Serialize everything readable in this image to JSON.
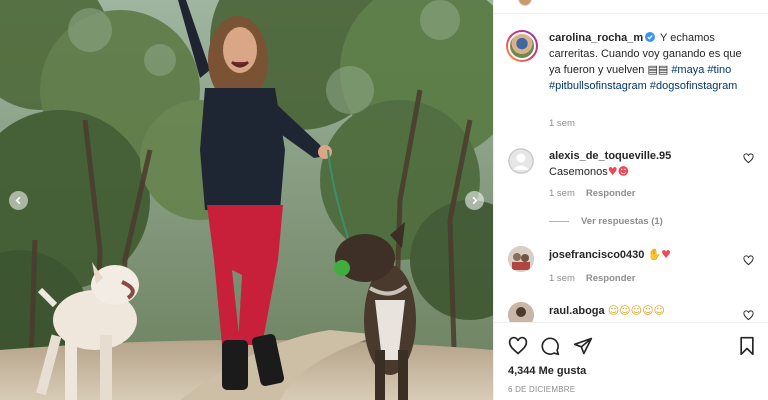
{
  "post": {
    "username": "carolina_rocha_m",
    "caption_text": "Y echamos carreritas. Cuando voy ganando es que ya fueron y vuelven",
    "caption_emoji": "▤▤",
    "hashtags": [
      "#maya",
      "#tino",
      "#pitbullsofinstagram",
      "#dogsofinstagram"
    ],
    "time": "1 sem"
  },
  "comments": [
    {
      "username": "alexis_de_toqueville.95",
      "text": "Casemonos",
      "emoji": "♥☻",
      "time": "1 sem",
      "reply_label": "Responder"
    },
    {
      "username": "josefrancisco0430",
      "text": "",
      "emoji": "✋♥",
      "time": "1 sem",
      "reply_label": "Responder"
    },
    {
      "username": "raul.aboga",
      "text": "",
      "emoji": "☺☺☺☺☺",
      "time": "",
      "reply_label": ""
    }
  ],
  "view_replies_label": "Ver respuestas (1)",
  "likes_label": "4,344 Me gusta",
  "date_label": "6 DE DICIEMBRE",
  "icons": {
    "like": "heart-icon",
    "comment": "comment-icon",
    "share": "share-icon",
    "save": "bookmark-icon",
    "verified": "verified-badge-icon",
    "prev": "chevron-left-icon",
    "next": "chevron-right-icon"
  },
  "colors": {
    "link": "#00376b",
    "verified": "#3897f0",
    "muted": "#8e8e8e",
    "text": "#262626",
    "reaction_red": "#ed4956"
  }
}
